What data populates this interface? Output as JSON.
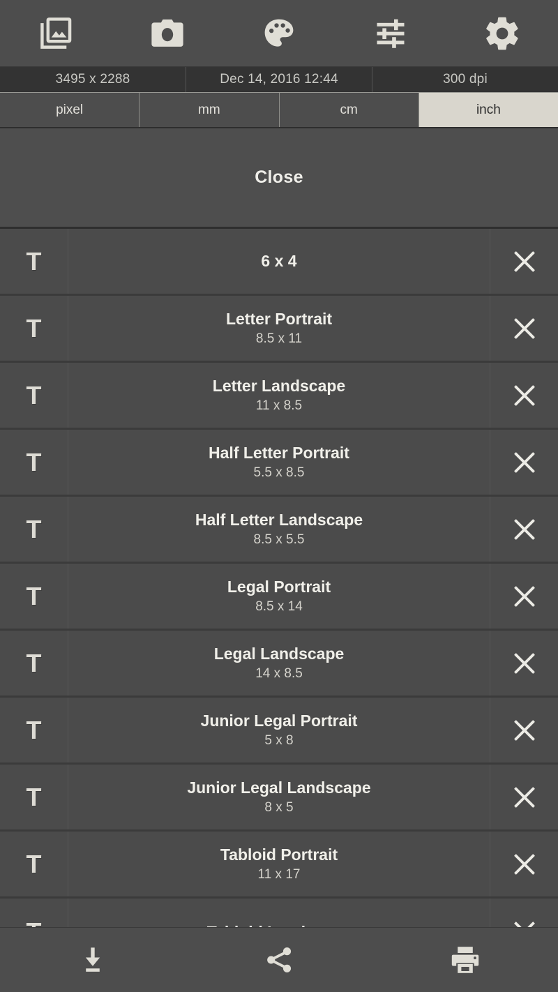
{
  "topbar": {
    "buttons": [
      {
        "name": "gallery-icon",
        "label": "Gallery"
      },
      {
        "name": "camera-icon",
        "label": "Camera"
      },
      {
        "name": "palette-icon",
        "label": "Palette"
      },
      {
        "name": "tune-icon",
        "label": "Adjust"
      },
      {
        "name": "gear-icon",
        "label": "Settings"
      }
    ]
  },
  "info": {
    "dimensions": "3495 x 2288",
    "date": "Dec 14, 2016 12:44",
    "dpi": "300 dpi"
  },
  "units": {
    "selected": "inch",
    "options": [
      "pixel",
      "mm",
      "cm",
      "inch"
    ]
  },
  "close": {
    "label": "Close"
  },
  "list": {
    "text_icon_glyph": "T",
    "rows": [
      {
        "title": "6 x 4",
        "sub": ""
      },
      {
        "title": "Letter Portrait",
        "sub": "8.5 x 11"
      },
      {
        "title": "Letter Landscape",
        "sub": "11 x 8.5"
      },
      {
        "title": "Half Letter Portrait",
        "sub": "5.5 x 8.5"
      },
      {
        "title": "Half Letter Landscape",
        "sub": "8.5 x 5.5"
      },
      {
        "title": "Legal Portrait",
        "sub": "8.5 x 14"
      },
      {
        "title": "Legal Landscape",
        "sub": "14 x 8.5"
      },
      {
        "title": "Junior Legal Portrait",
        "sub": "5 x 8"
      },
      {
        "title": "Junior Legal Landscape",
        "sub": "8 x 5"
      },
      {
        "title": "Tabloid Portrait",
        "sub": "11 x 17"
      },
      {
        "title": "Tabloid Landscape",
        "sub": ""
      }
    ]
  },
  "bottombar": {
    "buttons": [
      {
        "name": "download-icon",
        "label": "Save"
      },
      {
        "name": "share-icon",
        "label": "Share"
      },
      {
        "name": "print-icon",
        "label": "Print"
      }
    ]
  },
  "colors": {
    "app_background": "#4a4a4a",
    "bar_background": "#4d4d4d",
    "info_background": "#333333",
    "row_background": "#4b4b4b",
    "row_divider": "#3b3b3b",
    "icon_foreground": "#e0ded6",
    "text_primary": "#f0efe9",
    "text_secondary": "#d6d4cd",
    "tab_selected_background": "#d9d6cd",
    "tab_selected_text": "#2b2b2b"
  }
}
